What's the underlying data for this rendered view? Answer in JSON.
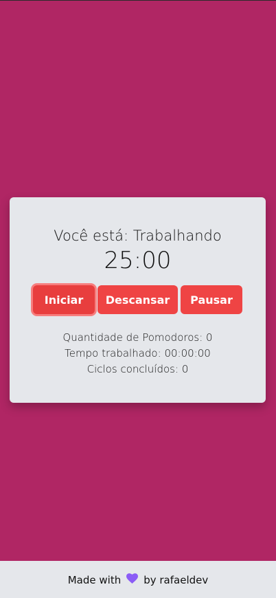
{
  "status": {
    "prefix": "Você está:",
    "mode": "Trabalhando"
  },
  "timer": {
    "display": "25:00"
  },
  "buttons": {
    "start": "Iniciar",
    "rest": "Descansar",
    "pause": "Pausar"
  },
  "stats": {
    "pomodoros_label": "Quantidade de Pomodoros:",
    "pomodoros_value": "0",
    "worked_label": "Tempo trabalhado:",
    "worked_value": "00:00:00",
    "cycles_label": "Ciclos concluídos:",
    "cycles_value": "0"
  },
  "footer": {
    "made_with": "Made with",
    "heart_icon": "heart-icon",
    "by": "by rafaeldev"
  },
  "colors": {
    "background": "#b02664",
    "card": "#e5e7eb",
    "button": "#ef4444",
    "heart": "#8b5cf6"
  }
}
